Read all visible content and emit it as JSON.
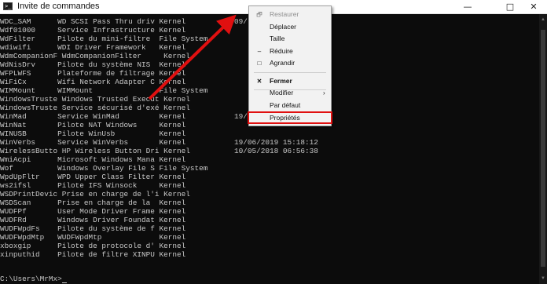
{
  "window": {
    "title": "Invite de commandes",
    "icon": "cmd-icon",
    "minimize_glyph": "—",
    "maximize_glyph": "□",
    "close_glyph": "✕"
  },
  "console": {
    "lines": [
      "WDC_SAM      WD SCSI Pass Thru driv Kernel",
      "Wdf01000     Service Infrastructure Kernel",
      "WdFilter     Pilote du mini-filtre  File System",
      "wdiwifi      WDI Driver Framework   Kernel",
      "WdmCompanionF WdmCompanionFilter     Kernel",
      "WdNisDrv     Pilote du système NIS  Kernel",
      "WFPLWFS      Plateforme de filtrage Kernel",
      "WiFiCx       Wifi Network Adapter C Kernel",
      "WIMMount     WIMMount               File System",
      "WindowsTruste Windows Trusted Execut Kernel",
      "WindowsTruste Service sécurisé d'exé Kernel",
      "WinMad       Service WinMad         Kernel",
      "WinNat       Pilote NAT Windows     Kernel",
      "WINUSB       Pilote WinUsb          Kernel",
      "WinVerbs     Service WinVerbs       Kernel",
      "WirelessButto HP Wireless Button Dri Kernel",
      "WmiAcpi      Microsoft Windows Mana Kernel",
      "Wof          Windows Overlay File S File System",
      "WpdUpFltr    WPD Upper Class Filter Kernel",
      "ws2ifsl      Pilote IFS Winsock     Kernel",
      "WSDPrintDevic Prise en charge de l'i Kernel",
      "WSDScan      Prise en charge de la  Kernel",
      "WUDFPf       User Mode Driver Frame Kernel",
      "WUDFRd       Windows Driver Foundat Kernel",
      "WUDFWpdFs    Pilote du système de f Kernel",
      "WUDFWpdMtp   WUDFWpdMtp             Kernel",
      "xboxgip      Pilote de protocole d' Kernel",
      "xinputhid    Pilote de filtre XINPU Kernel"
    ],
    "dates": {
      "row0": "09/",
      "row11": "19/",
      "row14": "19/06/2019 15:18:12",
      "row15": "10/05/2018 06:56:38"
    },
    "prompt": "C:\\Users\\MrMx>"
  },
  "context_menu": {
    "items": [
      {
        "label": "Restaurer",
        "icon": "restore-icon",
        "glyph": "🗗",
        "enabled": false
      },
      {
        "label": "Déplacer",
        "icon": "",
        "glyph": "",
        "enabled": true
      },
      {
        "label": "Taille",
        "icon": "",
        "glyph": "",
        "enabled": true
      },
      {
        "label": "Réduire",
        "icon": "minimize-icon",
        "glyph": "–",
        "enabled": true
      },
      {
        "label": "Agrandir",
        "icon": "maximize-icon",
        "glyph": "□",
        "enabled": true
      },
      {
        "label": "Fermer",
        "icon": "close-icon",
        "glyph": "✕",
        "enabled": true,
        "bold": true
      },
      {
        "label": "Modifier",
        "icon": "",
        "glyph": "",
        "enabled": true,
        "submenu_glyph": "›"
      },
      {
        "label": "Par défaut",
        "icon": "",
        "glyph": "",
        "enabled": true
      },
      {
        "label": "Propriétés",
        "icon": "",
        "glyph": "",
        "enabled": true
      }
    ]
  },
  "annotation": {
    "highlight_color": "#e01010",
    "arrow_color": "#e01010"
  }
}
